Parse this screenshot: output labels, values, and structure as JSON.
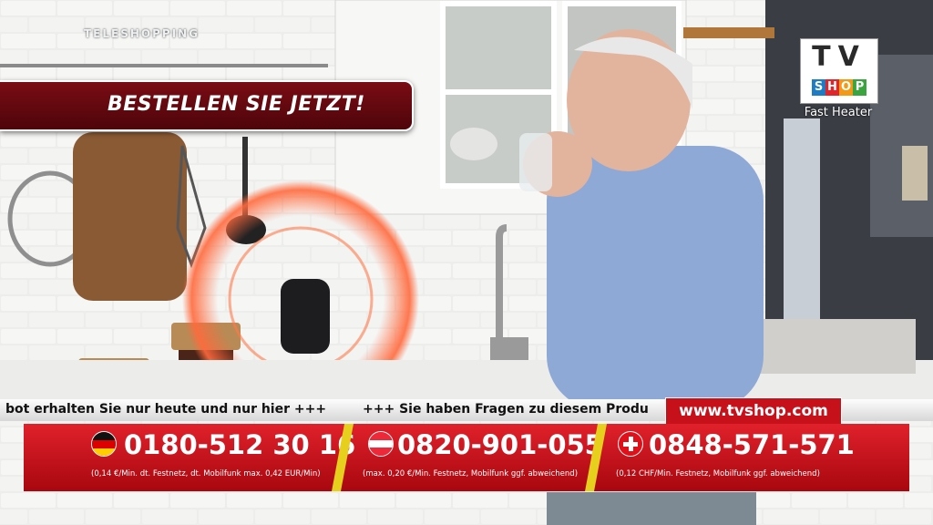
{
  "overlay": {
    "channel_label": "TELESHOPPING",
    "banner_text": "BESTELLEN SIE JETZT!",
    "logo": {
      "top": "TV",
      "bottom": [
        "S",
        "H",
        "O",
        "P"
      ],
      "bottom_colors": [
        "#1d7cc4",
        "#e0262b",
        "#f29a16",
        "#3aa53f"
      ]
    },
    "product_name": "Fast Heater"
  },
  "ticker": {
    "text_left": "bot erhalten Sie nur heute und nur hier +++",
    "text_right": "+++ Sie haben Fragen zu diesem Produ",
    "url": "www.tvshop.com"
  },
  "phones": [
    {
      "country": "Germany",
      "number": "0180-512 30 16",
      "note": "(0,14 €/Min. dt. Festnetz, dt. Mobilfunk max. 0,42 EUR/Min)"
    },
    {
      "country": "Austria",
      "number": "0820-901-055",
      "note": "(max. 0,20 €/Min. Festnetz, Mobilfunk ggf. abweichend)"
    },
    {
      "country": "Switzerland",
      "number": "0848-571-571",
      "note": "(0,12 CHF/Min. Festnetz, Mobilfunk ggf. abweichend)"
    }
  ],
  "colors": {
    "accent_red": "#d4111b",
    "banner_maroon": "#6a0a12",
    "separator_yellow": "#e7cf1d",
    "halo": "#ff6a3d"
  }
}
